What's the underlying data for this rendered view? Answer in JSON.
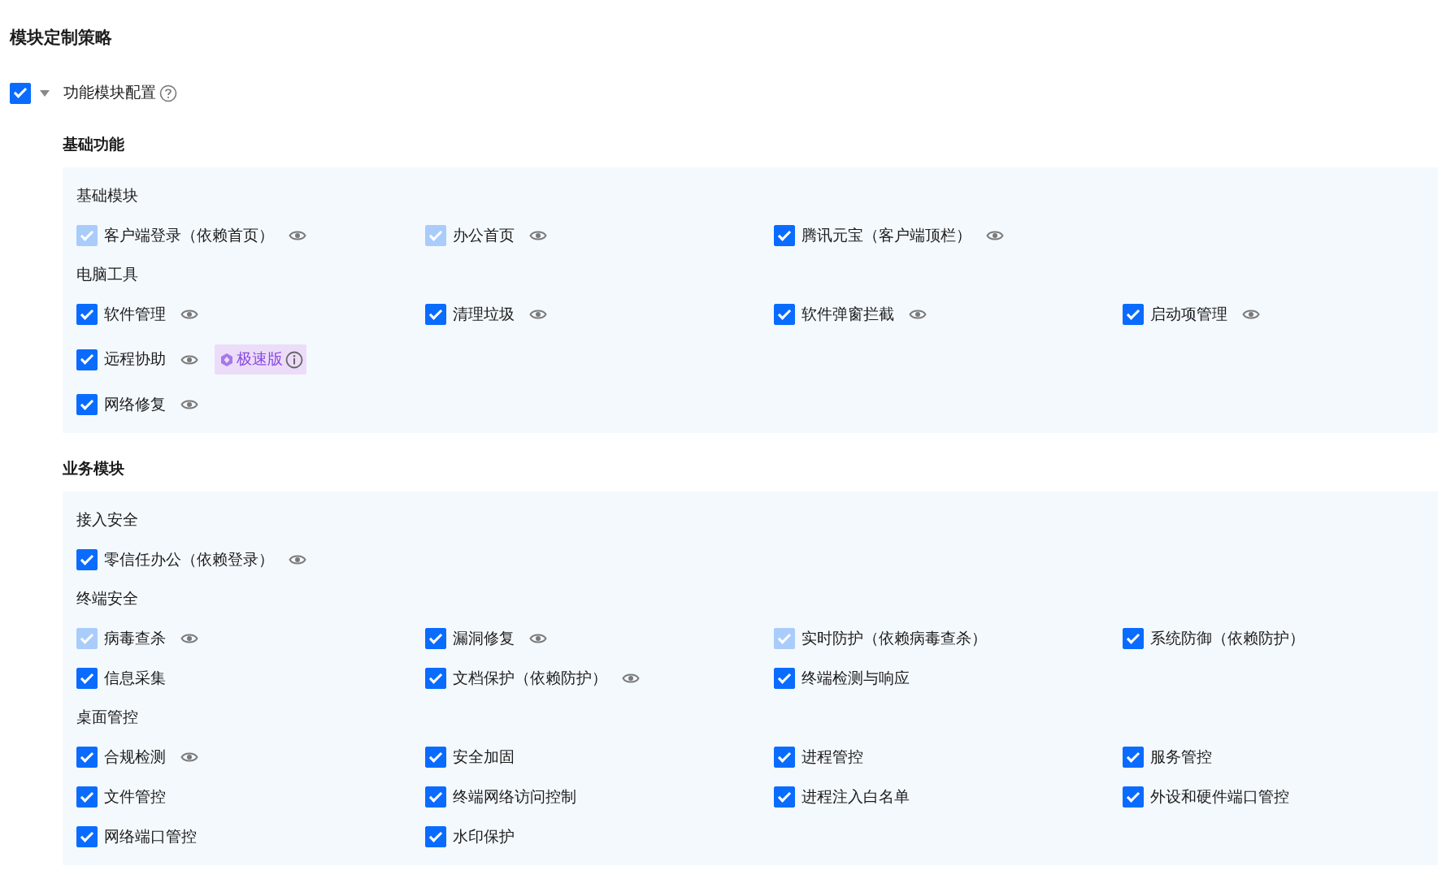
{
  "title": "模块定制策略",
  "root": {
    "label": "功能模块配置",
    "checked": true,
    "expanded": true
  },
  "sections": [
    {
      "heading": "基础功能",
      "groups": [
        {
          "label": "基础模块",
          "rows": [
            [
              {
                "label": "客户端登录（依赖首页）",
                "checked": true,
                "disabled": true,
                "eye": true
              },
              {
                "label": "办公首页",
                "checked": true,
                "disabled": true,
                "eye": true
              },
              {
                "label": "腾讯元宝（客户端顶栏）",
                "checked": true,
                "disabled": false,
                "eye": true
              }
            ]
          ]
        },
        {
          "label": "电脑工具",
          "rows": [
            [
              {
                "label": "软件管理",
                "checked": true,
                "disabled": false,
                "eye": true
              },
              {
                "label": "清理垃圾",
                "checked": true,
                "disabled": false,
                "eye": true
              },
              {
                "label": "软件弹窗拦截",
                "checked": true,
                "disabled": false,
                "eye": true
              },
              {
                "label": "启动项管理",
                "checked": true,
                "disabled": false,
                "eye": true
              }
            ],
            [
              {
                "label": "远程协助",
                "checked": true,
                "disabled": false,
                "eye": true,
                "badge": "极速版"
              }
            ],
            [
              {
                "label": "网络修复",
                "checked": true,
                "disabled": false,
                "eye": true
              }
            ]
          ]
        }
      ]
    },
    {
      "heading": "业务模块",
      "groups": [
        {
          "label": "接入安全",
          "rows": [
            [
              {
                "label": "零信任办公（依赖登录）",
                "checked": true,
                "disabled": false,
                "eye": true
              }
            ]
          ]
        },
        {
          "label": "终端安全",
          "rows": [
            [
              {
                "label": "病毒查杀",
                "checked": true,
                "disabled": true,
                "eye": true
              },
              {
                "label": "漏洞修复",
                "checked": true,
                "disabled": false,
                "eye": true
              },
              {
                "label": "实时防护（依赖病毒查杀）",
                "checked": true,
                "disabled": true,
                "eye": false
              },
              {
                "label": "系统防御（依赖防护）",
                "checked": true,
                "disabled": false,
                "eye": false
              }
            ],
            [
              {
                "label": "信息采集",
                "checked": true,
                "disabled": false,
                "eye": false
              },
              {
                "label": "文档保护（依赖防护）",
                "checked": true,
                "disabled": false,
                "eye": true
              },
              {
                "label": "终端检测与响应",
                "checked": true,
                "disabled": false,
                "eye": false
              }
            ]
          ]
        },
        {
          "label": "桌面管控",
          "rows": [
            [
              {
                "label": "合规检测",
                "checked": true,
                "disabled": false,
                "eye": true
              },
              {
                "label": "安全加固",
                "checked": true,
                "disabled": false,
                "eye": false
              },
              {
                "label": "进程管控",
                "checked": true,
                "disabled": false,
                "eye": false
              },
              {
                "label": "服务管控",
                "checked": true,
                "disabled": false,
                "eye": false
              }
            ],
            [
              {
                "label": "文件管控",
                "checked": true,
                "disabled": false,
                "eye": false
              },
              {
                "label": "终端网络访问控制",
                "checked": true,
                "disabled": false,
                "eye": false
              },
              {
                "label": "进程注入白名单",
                "checked": true,
                "disabled": false,
                "eye": false
              },
              {
                "label": "外设和硬件端口管控",
                "checked": true,
                "disabled": false,
                "eye": false
              }
            ],
            [
              {
                "label": "网络端口管控",
                "checked": true,
                "disabled": false,
                "eye": false
              },
              {
                "label": "水印保护",
                "checked": true,
                "disabled": false,
                "eye": false
              }
            ]
          ]
        }
      ]
    }
  ]
}
